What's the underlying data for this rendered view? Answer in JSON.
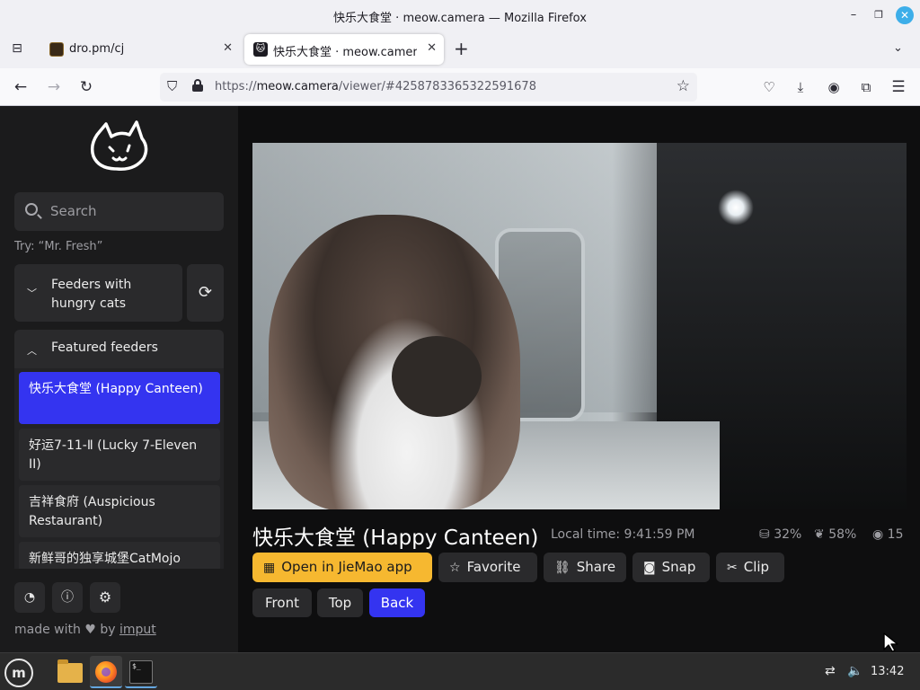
{
  "window": {
    "title": "快乐大食堂 · meow.camera — Mozilla Firefox"
  },
  "tabs": [
    {
      "label": "dro.pm/cj",
      "active": false
    },
    {
      "label": "快乐大食堂 · meow.camera",
      "active": true
    }
  ],
  "navbar": {
    "url_prefix": "https://",
    "url_host": "meow.camera",
    "url_rest": "/viewer/#4258783365322591678"
  },
  "sidebar": {
    "search_placeholder": "Search",
    "hint": "Try: “Mr. Fresh”",
    "hungry_section_label": "Feeders with hungry cats",
    "featured_section_label": "Featured feeders",
    "featured_items": [
      {
        "label": "快乐大食堂 (Happy Canteen)",
        "selected": true
      },
      {
        "label": "好运7-11-Ⅱ (Lucky 7-Eleven II)",
        "selected": false
      },
      {
        "label": "吉祥食府 (Auspicious Restaurant)",
        "selected": false
      },
      {
        "label": "新鲜哥的独享城堡CatMojo",
        "selected": false
      }
    ],
    "made_with": "made with",
    "by": "by",
    "author": "imput"
  },
  "viewer": {
    "feeder_title": "快乐大食堂 (Happy Canteen)",
    "local_time": "Local time: 9:41:59 PM",
    "food_level": "32%",
    "hunger_level": "58%",
    "viewers": "15",
    "buttons": {
      "open_app": "Open in JieMao app",
      "favorite": "Favorite",
      "share": "Share",
      "snap": "Snap",
      "clip": "Clip"
    },
    "views": {
      "front": "Front",
      "top": "Top",
      "back": "Back",
      "selected": "Back"
    }
  },
  "taskbar": {
    "clock": "13:42"
  },
  "colors": {
    "accent_blue": "#3434f0",
    "app_button_yellow": "#f6b830",
    "sidebar_bg": "#1b1b1c",
    "page_bg": "#0e0e0f"
  },
  "icons": [
    "tab-list-icon",
    "close-tab-icon",
    "new-tab-icon",
    "back-icon",
    "forward-icon",
    "reload-icon",
    "tracking-shield-icon",
    "lock-icon",
    "bookmark-star-icon",
    "pocket-icon",
    "download-icon",
    "account-icon",
    "extensions-icon",
    "menu-icon",
    "cat-logo-icon",
    "search-icon",
    "chevron-down-icon",
    "chevron-up-icon",
    "refresh-icon",
    "discord-icon",
    "info-icon",
    "gear-icon",
    "heart-icon",
    "qr-code-icon",
    "star-icon",
    "link-icon",
    "camera-icon",
    "scissors-icon",
    "food-icon",
    "hunger-icon",
    "eye-icon"
  ]
}
